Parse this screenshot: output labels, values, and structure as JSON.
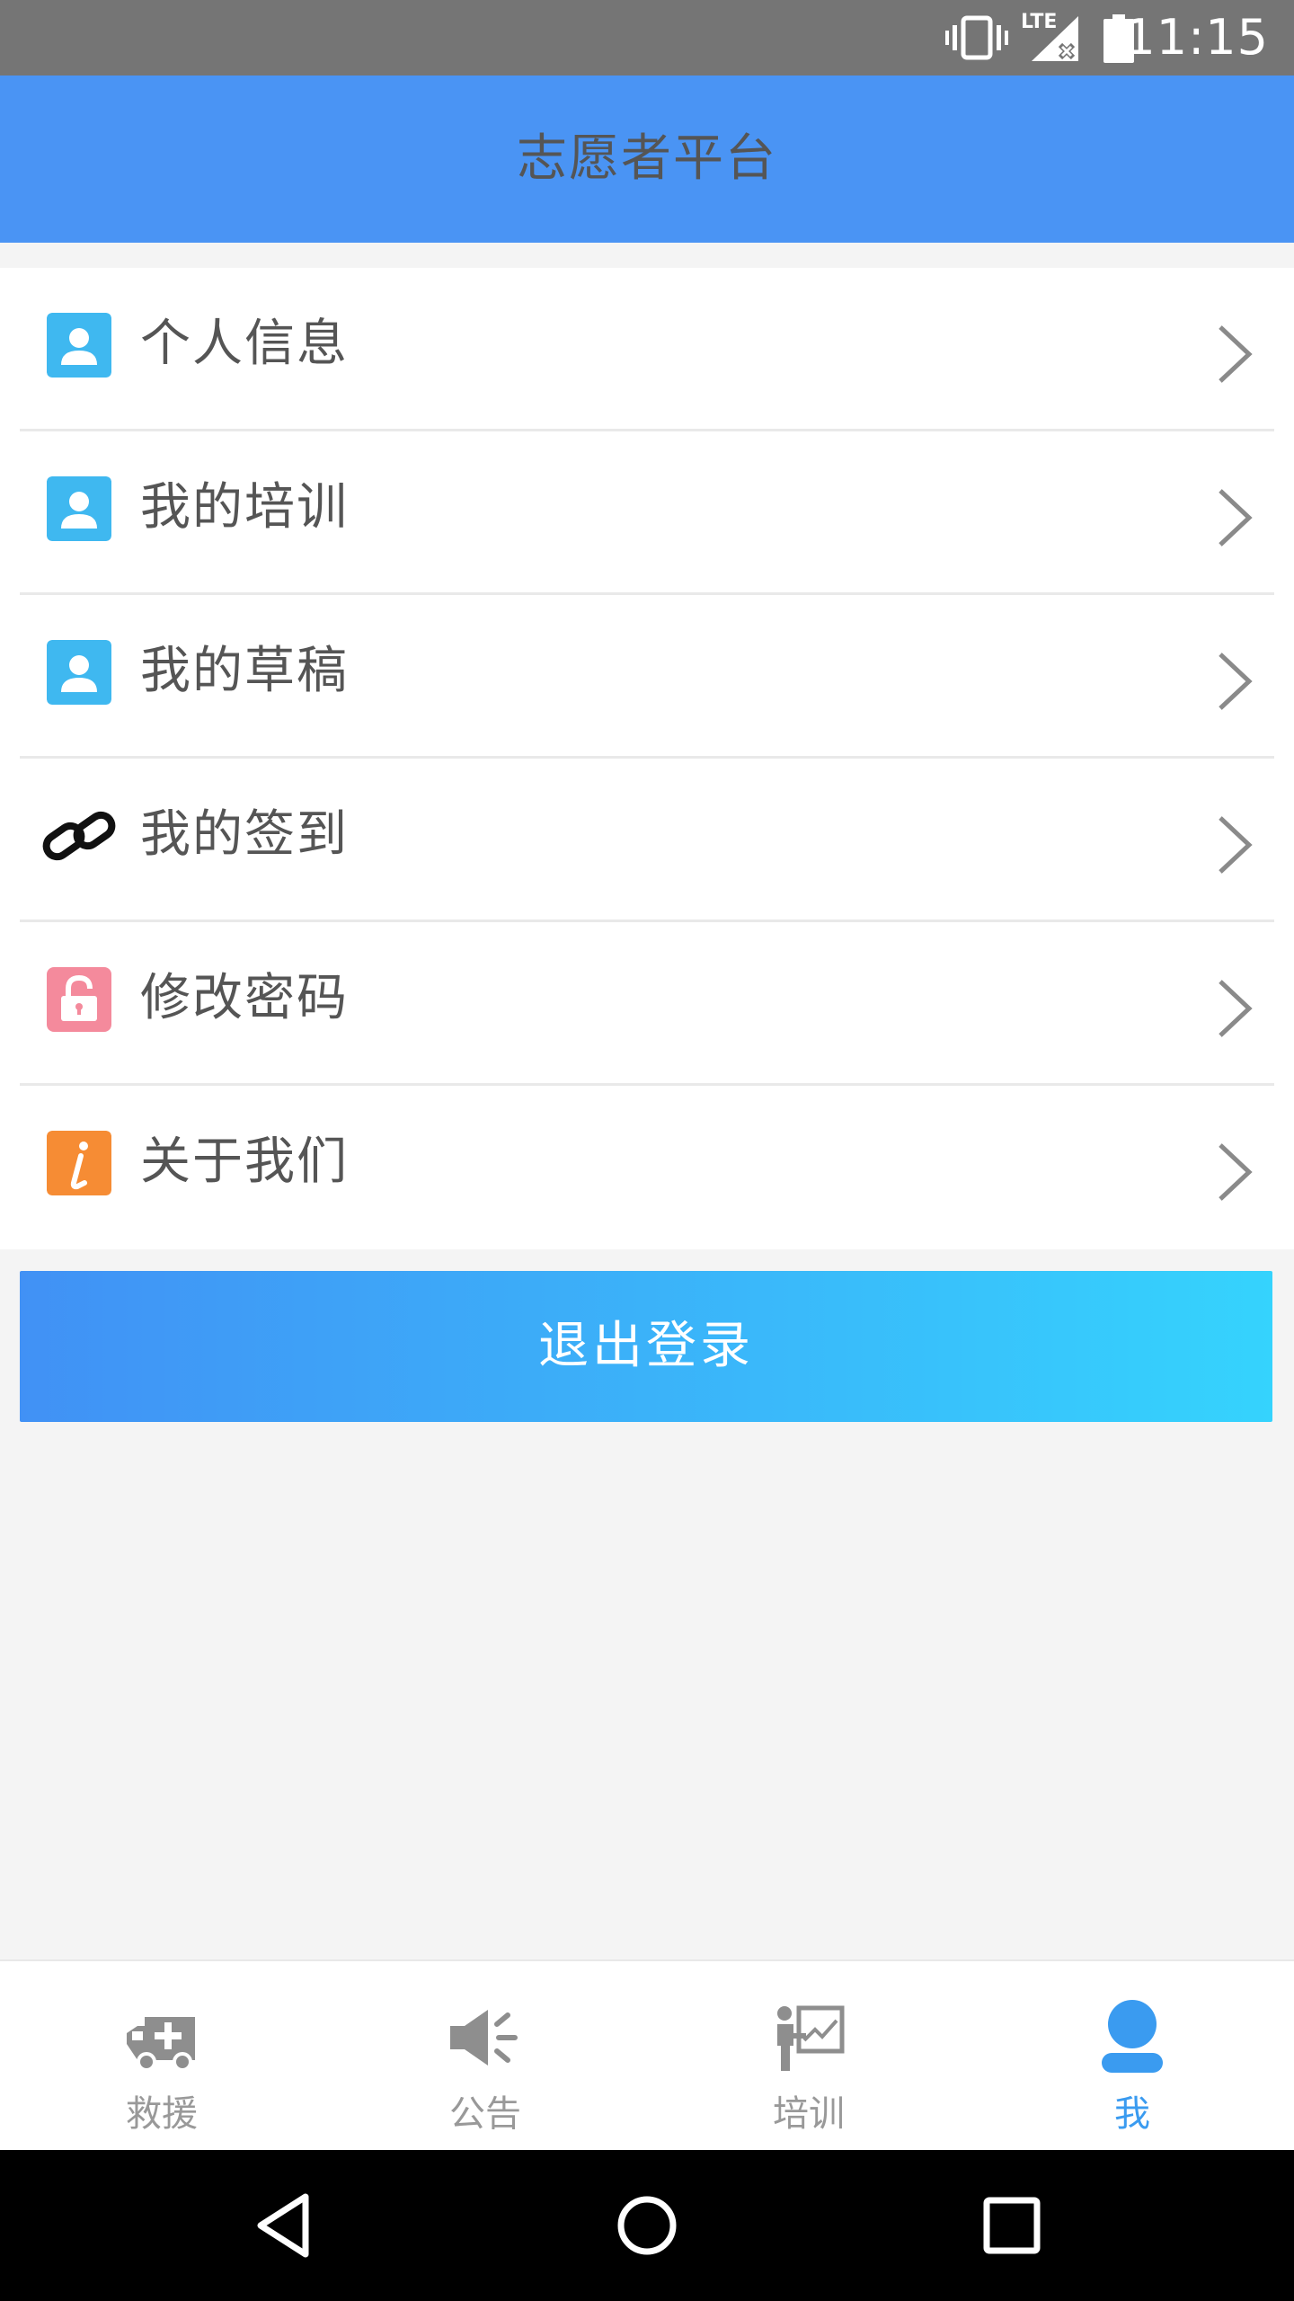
{
  "status_bar": {
    "time": "11:15",
    "network": "LTE"
  },
  "header": {
    "title": "志愿者平台"
  },
  "menu": {
    "items": [
      {
        "label": "个人信息",
        "icon": "person-icon",
        "color": "#3fb8f0"
      },
      {
        "label": "我的培训",
        "icon": "person-icon",
        "color": "#3fb8f0"
      },
      {
        "label": "我的草稿",
        "icon": "person-icon",
        "color": "#3fb8f0"
      },
      {
        "label": "我的签到",
        "icon": "link-icon",
        "color": "#111111"
      },
      {
        "label": "修改密码",
        "icon": "lock-icon",
        "color": "#f48a9c"
      },
      {
        "label": "关于我们",
        "icon": "info-icon",
        "color": "#f68c34"
      }
    ]
  },
  "logout_button": {
    "label": "退出登录"
  },
  "tabbar": {
    "tabs": [
      {
        "label": "救援",
        "icon": "ambulance-icon",
        "active": false
      },
      {
        "label": "公告",
        "icon": "megaphone-icon",
        "active": false
      },
      {
        "label": "培训",
        "icon": "training-icon",
        "active": false
      },
      {
        "label": "我",
        "icon": "user-icon",
        "active": true
      }
    ]
  },
  "colors": {
    "header": "#4a94f4",
    "accent": "#3a9bf0",
    "logout_start": "#4191f5",
    "logout_end": "#35d3fd"
  }
}
